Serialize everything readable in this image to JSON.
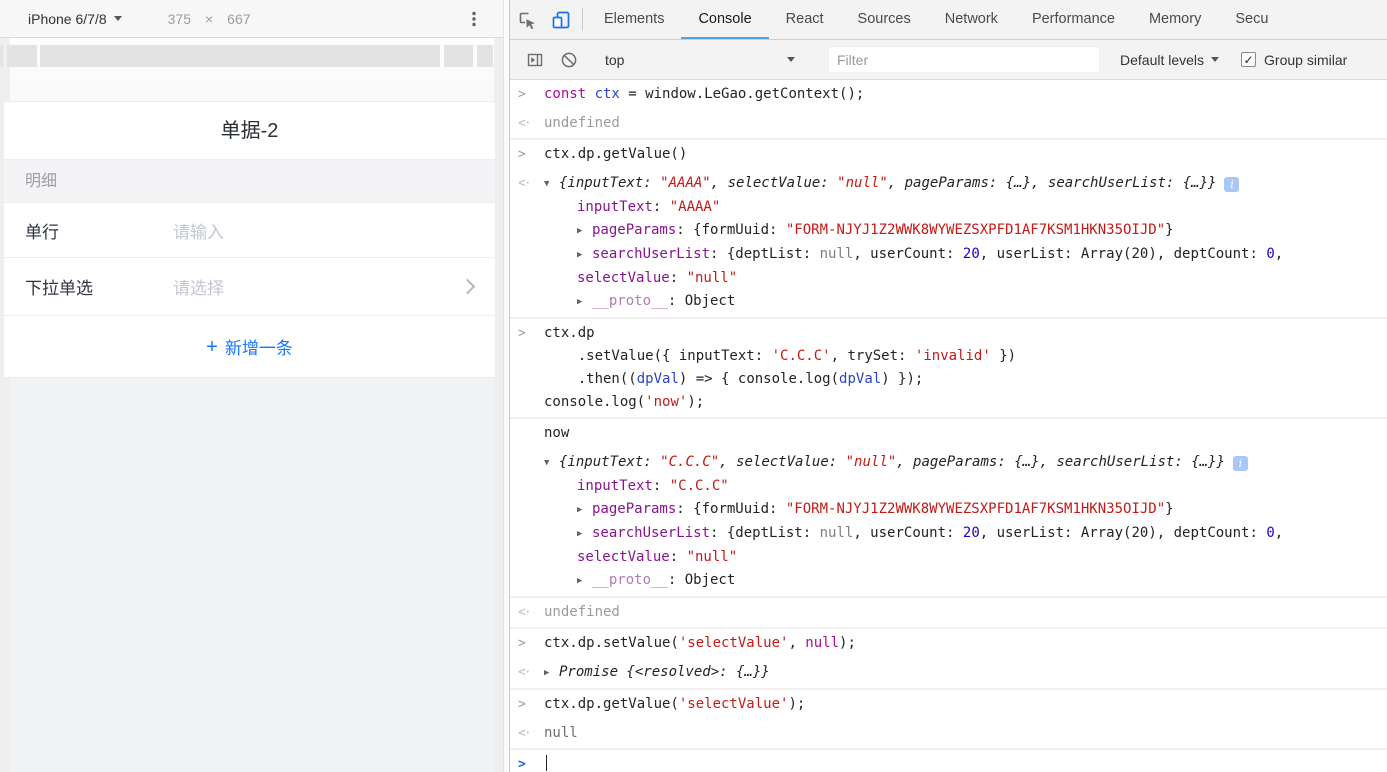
{
  "device_toolbar": {
    "device_label": "iPhone 6/7/8",
    "width": "375",
    "multiply": "×",
    "height": "667"
  },
  "emulated_page": {
    "form_title": "单据-2",
    "section_header": "明细",
    "fields": [
      {
        "label": "单行",
        "placeholder": "请输入"
      },
      {
        "label": "下拉单选",
        "placeholder": "请选择"
      }
    ],
    "add_button": {
      "plus": "+",
      "label": "新增一条"
    },
    "accent_color": "#1677ff"
  },
  "devtools": {
    "tabs": [
      {
        "label": "Elements",
        "active": false
      },
      {
        "label": "Console",
        "active": true
      },
      {
        "label": "React",
        "active": false
      },
      {
        "label": "Sources",
        "active": false
      },
      {
        "label": "Network",
        "active": false
      },
      {
        "label": "Performance",
        "active": false
      },
      {
        "label": "Memory",
        "active": false
      },
      {
        "label": "Secu",
        "active": false
      }
    ],
    "console_toolbar": {
      "context_selector": "top",
      "filter_placeholder": "Filter",
      "levels_label": "Default levels",
      "group_similar_label": "Group similar",
      "group_similar_checked": true
    },
    "colors": {
      "active_tab_underline": "#56a0e4",
      "device_icon_active": "#1a73e8",
      "string": "#c41a16",
      "object_key": "#881391",
      "number": "#1c00cf",
      "keyword": "#aa0d91",
      "muted_result": "#9b9b9b"
    },
    "console": {
      "messages": [
        {
          "type": "input",
          "border": false,
          "lines": [
            {
              "m": "in",
              "tokens": [
                [
                  "kw",
                  "const "
                ],
                [
                  "var",
                  "ctx"
                ],
                [
                  "p",
                  " = window.LeGao.getContext();"
                ]
              ]
            }
          ]
        },
        {
          "type": "result",
          "border": true,
          "lines": [
            {
              "m": "out",
              "tokens": [
                [
                  "gray",
                  "undefined"
                ]
              ]
            }
          ]
        },
        {
          "type": "input",
          "border": false,
          "lines": [
            {
              "m": "in",
              "tokens": [
                [
                  "p",
                  "ctx.dp.getValue()"
                ]
              ]
            }
          ]
        },
        {
          "type": "result",
          "border": true,
          "lines": [
            {
              "m": "out",
              "tri": "open",
              "info": true,
              "tokens": [
                [
                  "it",
                  "{inputText: "
                ],
                [
                  "itstr",
                  "\"AAAA\""
                ],
                [
                  "it",
                  ", selectValue: "
                ],
                [
                  "itstr",
                  "\"null\""
                ],
                [
                  "it",
                  ", pageParams: {…}, searchUserList: {…}}"
                ]
              ]
            },
            {
              "indent": 1,
              "tokens": [
                [
                  "key",
                  "inputText"
                ],
                [
                  "p",
                  ": "
                ],
                [
                  "str",
                  "\"AAAA\""
                ]
              ]
            },
            {
              "indent": 1,
              "tri": "closed",
              "tokens": [
                [
                  "key",
                  "pageParams"
                ],
                [
                  "p",
                  ": {formUuid: "
                ],
                [
                  "str",
                  "\"FORM-NJYJ1Z2WWK8WYWEZSXPFD1AF7KSM1HKN35OIJD\""
                ],
                [
                  "p",
                  "}"
                ]
              ]
            },
            {
              "indent": 1,
              "tri": "closed",
              "tokens": [
                [
                  "key",
                  "searchUserList"
                ],
                [
                  "p",
                  ": {deptList: "
                ],
                [
                  "null",
                  "null"
                ],
                [
                  "p",
                  ", userCount: "
                ],
                [
                  "num",
                  "20"
                ],
                [
                  "p",
                  ", userList: Array(20), deptCount: "
                ],
                [
                  "num",
                  "0"
                ],
                [
                  "p",
                  ","
                ]
              ]
            },
            {
              "indent": 1,
              "tokens": [
                [
                  "key",
                  "selectValue"
                ],
                [
                  "p",
                  ": "
                ],
                [
                  "str",
                  "\"null\""
                ]
              ]
            },
            {
              "indent": 1,
              "tri": "closed",
              "tokens": [
                [
                  "proto",
                  "__proto__"
                ],
                [
                  "p",
                  ": Object"
                ]
              ]
            }
          ]
        },
        {
          "type": "input",
          "border": true,
          "lines": [
            {
              "m": "in",
              "tokens": [
                [
                  "p",
                  "ctx.dp"
                ]
              ]
            },
            {
              "tokens": [
                [
                  "p",
                  "    .setValue({ inputText: "
                ],
                [
                  "str",
                  "'C.C.C'"
                ],
                [
                  "p",
                  ", trySet: "
                ],
                [
                  "str",
                  "'invalid'"
                ],
                [
                  "p",
                  " })"
                ]
              ]
            },
            {
              "tokens": [
                [
                  "p",
                  "    .then(("
                ],
                [
                  "var",
                  "dpVal"
                ],
                [
                  "p",
                  ") => { console.log("
                ],
                [
                  "var",
                  "dpVal"
                ],
                [
                  "p",
                  ") });"
                ]
              ]
            },
            {
              "tokens": [
                [
                  "p",
                  "console.log("
                ],
                [
                  "str",
                  "'now'"
                ],
                [
                  "p",
                  ");"
                ]
              ]
            }
          ]
        },
        {
          "type": "log",
          "border": false,
          "lines": [
            {
              "tokens": [
                [
                  "p",
                  "now"
                ]
              ]
            }
          ]
        },
        {
          "type": "log",
          "border": true,
          "lines": [
            {
              "tri": "open",
              "info": true,
              "tokens": [
                [
                  "it",
                  "{inputText: "
                ],
                [
                  "itstr",
                  "\"C.C.C\""
                ],
                [
                  "it",
                  ", selectValue: "
                ],
                [
                  "itstr",
                  "\"null\""
                ],
                [
                  "it",
                  ", pageParams: {…}, searchUserList: {…}}"
                ]
              ]
            },
            {
              "indent": 1,
              "tokens": [
                [
                  "key",
                  "inputText"
                ],
                [
                  "p",
                  ": "
                ],
                [
                  "str",
                  "\"C.C.C\""
                ]
              ]
            },
            {
              "indent": 1,
              "tri": "closed",
              "tokens": [
                [
                  "key",
                  "pageParams"
                ],
                [
                  "p",
                  ": {formUuid: "
                ],
                [
                  "str",
                  "\"FORM-NJYJ1Z2WWK8WYWEZSXPFD1AF7KSM1HKN35OIJD\""
                ],
                [
                  "p",
                  "}"
                ]
              ]
            },
            {
              "indent": 1,
              "tri": "closed",
              "tokens": [
                [
                  "key",
                  "searchUserList"
                ],
                [
                  "p",
                  ": {deptList: "
                ],
                [
                  "null",
                  "null"
                ],
                [
                  "p",
                  ", userCount: "
                ],
                [
                  "num",
                  "20"
                ],
                [
                  "p",
                  ", userList: Array(20), deptCount: "
                ],
                [
                  "num",
                  "0"
                ],
                [
                  "p",
                  ","
                ]
              ]
            },
            {
              "indent": 1,
              "tokens": [
                [
                  "key",
                  "selectValue"
                ],
                [
                  "p",
                  ": "
                ],
                [
                  "str",
                  "\"null\""
                ]
              ]
            },
            {
              "indent": 1,
              "tri": "closed",
              "tokens": [
                [
                  "proto",
                  "__proto__"
                ],
                [
                  "p",
                  ": Object"
                ]
              ]
            }
          ]
        },
        {
          "type": "result",
          "border": true,
          "lines": [
            {
              "m": "out",
              "tokens": [
                [
                  "gray",
                  "undefined"
                ]
              ]
            }
          ]
        },
        {
          "type": "input",
          "border": false,
          "lines": [
            {
              "m": "in",
              "tokens": [
                [
                  "p",
                  "ctx.dp.setValue("
                ],
                [
                  "str",
                  "'selectValue'"
                ],
                [
                  "p",
                  ", "
                ],
                [
                  "kw",
                  "null"
                ],
                [
                  "p",
                  ");"
                ]
              ]
            }
          ]
        },
        {
          "type": "result",
          "border": true,
          "lines": [
            {
              "m": "out",
              "tri": "closed",
              "tokens": [
                [
                  "it",
                  "Promise {<resolved>: {…}}"
                ]
              ]
            }
          ]
        },
        {
          "type": "input",
          "border": false,
          "lines": [
            {
              "m": "in",
              "tokens": [
                [
                  "p",
                  "ctx.dp.getValue("
                ],
                [
                  "str",
                  "'selectValue'"
                ],
                [
                  "p",
                  ");"
                ]
              ]
            }
          ]
        },
        {
          "type": "result",
          "border": true,
          "lines": [
            {
              "m": "out",
              "tokens": [
                [
                  "nullr",
                  "null"
                ]
              ]
            }
          ]
        },
        {
          "type": "prompt",
          "border": false,
          "lines": [
            {
              "m": "prompt",
              "caret": true,
              "tokens": []
            }
          ]
        }
      ]
    }
  }
}
